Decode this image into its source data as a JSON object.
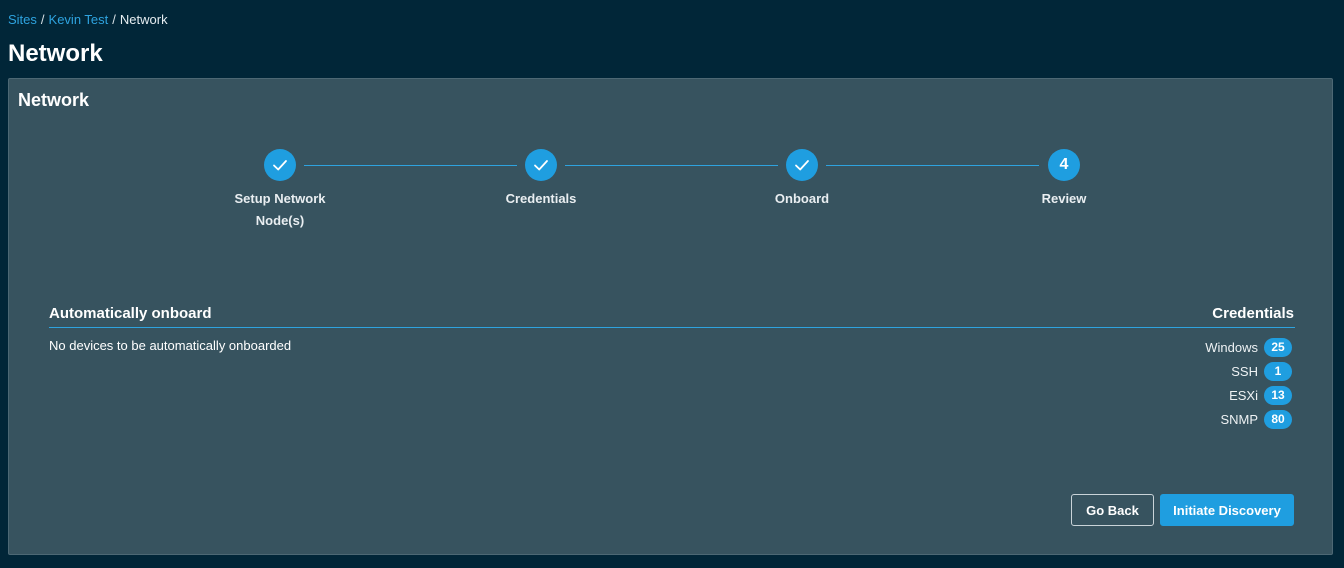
{
  "breadcrumb": {
    "items": [
      "Sites",
      "Kevin Test"
    ],
    "separator": "/",
    "current": "Network"
  },
  "page": {
    "title": "Network"
  },
  "panel": {
    "title": "Network"
  },
  "stepper": {
    "steps": [
      {
        "label": "Setup Network Node(s)",
        "status": "complete",
        "icon": "check-icon"
      },
      {
        "label": "Credentials",
        "status": "complete",
        "icon": "check-icon"
      },
      {
        "label": "Onboard",
        "status": "complete",
        "icon": "check-icon"
      },
      {
        "label": "Review",
        "status": "current",
        "number": "4"
      }
    ]
  },
  "onboard": {
    "heading": "Automatically onboard",
    "empty_message": "No devices to be automatically onboarded"
  },
  "credentials": {
    "heading": "Credentials",
    "items": [
      {
        "label": "Windows",
        "count": "25"
      },
      {
        "label": "SSH",
        "count": "1"
      },
      {
        "label": "ESXi",
        "count": "13"
      },
      {
        "label": "SNMP",
        "count": "80"
      }
    ]
  },
  "actions": {
    "back_label": "Go Back",
    "submit_label": "Initiate Discovery"
  },
  "colors": {
    "background": "#012638",
    "panel": "#37535f",
    "accent": "#1f9ee0",
    "link": "#2ea3df"
  }
}
